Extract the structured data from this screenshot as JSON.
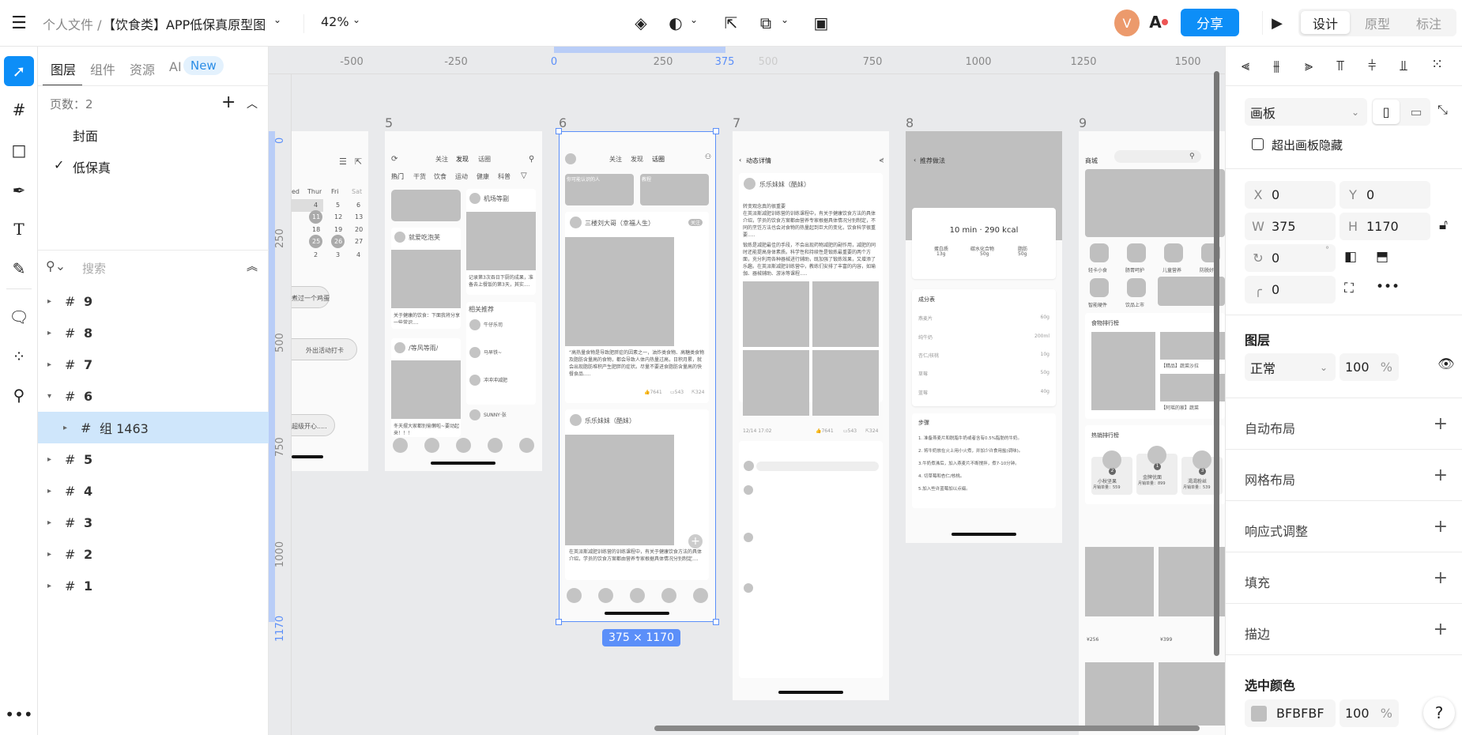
{
  "topbar": {
    "breadcrumb_root": "个人文件 /",
    "file_title": "【饮食类】APP低保真原型图",
    "zoom": "42%",
    "avatar_letter": "V",
    "share_label": "分享",
    "modes": [
      "设计",
      "原型",
      "标注"
    ],
    "active_mode": "设计"
  },
  "left_panel": {
    "tabs": [
      "图层",
      "组件",
      "资源",
      "AI"
    ],
    "new_badge": "New",
    "active_tab": "图层",
    "page_count_label": "页数：2",
    "pages": [
      {
        "name": "封面",
        "selected": false
      },
      {
        "name": "低保真",
        "selected": true
      }
    ],
    "search_placeholder": "搜索",
    "layers": [
      {
        "name": "9",
        "expanded": false
      },
      {
        "name": "8",
        "expanded": false
      },
      {
        "name": "7",
        "expanded": false
      },
      {
        "name": "6",
        "expanded": true
      },
      {
        "name": "组 1463",
        "expanded": false,
        "child": true,
        "selected": true
      },
      {
        "name": "5",
        "expanded": false
      },
      {
        "name": "4",
        "expanded": false
      },
      {
        "name": "3",
        "expanded": false
      },
      {
        "name": "2",
        "expanded": false
      },
      {
        "name": "1",
        "expanded": false
      }
    ]
  },
  "rulers": {
    "top": [
      "-500",
      "-250",
      "0",
      "250",
      "375",
      "500",
      "750",
      "1000",
      "1250",
      "1500"
    ],
    "left": [
      "0",
      "250",
      "500",
      "750",
      "1000",
      "1170"
    ]
  },
  "canvas": {
    "selection_size": "375 × 1170",
    "board4": {
      "weekdays": [
        "ed",
        "Thur",
        "Fri",
        "Sat"
      ],
      "rows": [
        [
          "4",
          "5",
          "6"
        ],
        [
          "11",
          "12",
          "13"
        ],
        [
          "18",
          "19",
          "20"
        ],
        [
          "25",
          "26",
          "27"
        ],
        [
          "2",
          "3",
          "4"
        ]
      ],
      "pills": [
        "煮过一个鸡蛋",
        "外出活动打卡",
        "超级开心....."
      ]
    },
    "board5": {
      "label": "5",
      "nav": [
        "关注",
        "发现",
        "话圈"
      ],
      "cats": [
        "热门",
        "干货",
        "饮食",
        "运动",
        "健康",
        "科普"
      ],
      "users": [
        "机场等副",
        "就爱吃泡芙",
        "/等风等雨/"
      ],
      "captions": [
        "记录第3次吞日下厨的成果，准备去上餐饭的第3天，其实....",
        "关于健康的饮食：下面我将分享一些常识....",
        "冬天摆大家都别偷懒啦~要动起来！！！"
      ],
      "related_title": "相关推荐",
      "related": [
        "牛仔乐司",
        "马早铁~",
        "冲冲冲减肥",
        "SUNNY·张"
      ]
    },
    "board6": {
      "label": "6",
      "nav": [
        "关注",
        "发现",
        "话圈"
      ],
      "cards": [
        "你可能认识的人",
        "教程"
      ],
      "post_user": "三楼刘大哥（幸福人生）",
      "follow": "关注",
      "post_text": "“高热量食物是导致肥胖症的因素之一，油炸类食物、高糖类食物及脂肪含量高的食物，都会导致人体内热量过高，日积月累，就会出现脂肪堆积产生肥胖的症状。尽量不要进食脂肪含量高的快餐食品.....",
      "likes": "7641",
      "comments": "543",
      "shares": "324",
      "post2_user": "乐乐妹妹（酷妹）",
      "post2_text": "在英派斯减肥训练营的训练课程中，有关于健康饮食方法的具体介绍，学员的饮食方案都由营养专家根据具体情况分别制定...."
    },
    "board7": {
      "label": "7",
      "title": "动态详情",
      "user": "乐乐妹妹（酷妹）",
      "headline": "转变观念真的很重要",
      "para1": "在英派斯减肥训练营的训练课程中，有关于健康饮食方法的具体介绍，学员的饮食方案都由营养专家根据具体情况分别制定，不同的烹饪方法也会对食物的热量起到巨大的变化，饮食科学很重要.....",
      "para2": "锻炼是减肥最佳的手段，不会出现药物减肥的副作用，减肥的同时还能提高身体素质。科学性和持续性是锻炼最重要的两个方面，充分利用各种器械进行辅助，既加强了锻炼效果，又增添了乐趣。在英派斯减肥训练营中，教练们安排了丰富的内容，如瑜伽、器械辅助、游泳等课程.....",
      "date": "12/14 17:02",
      "likes": "7641",
      "comments": "543",
      "shares": "324"
    },
    "board8": {
      "label": "8",
      "title": "推荐做法",
      "summary": "10 min  ·  290 kcal",
      "nutrients": [
        {
          "name": "蛋白质",
          "value": "13g"
        },
        {
          "name": "碳水化合物",
          "value": "50g"
        },
        {
          "name": "脂肪",
          "value": "50g"
        }
      ],
      "ingredients_title": "成分表",
      "ingredients": [
        {
          "name": "燕麦片",
          "amount": "60g"
        },
        {
          "name": "纯牛奶",
          "amount": "200ml"
        },
        {
          "name": "杏仁/核桃",
          "amount": "10g"
        },
        {
          "name": "草莓",
          "amount": "50g"
        },
        {
          "name": "蓝莓",
          "amount": "40g"
        }
      ],
      "steps_title": "步骤",
      "steps": [
        "1. 准备燕麦片和脱脂牛奶或者含有0.5%脂肪的牛奶。",
        "2. 将牛奶放在火上用小火煮，并加少许食用盐(调味)。",
        "3.牛奶煮沸后，加入燕麦片不断搅拌，煮7-10分钟。",
        "4. 切草莓和杏仁/核桃。",
        "5.加入些许蓝莓加以点缀。"
      ]
    },
    "board9": {
      "label": "9",
      "title": "商城",
      "categories": [
        "轻卡小食",
        "肠胃呵护",
        "儿童营养",
        "防脱好物",
        "智能硬件",
        "饮品上市"
      ],
      "ranking_title": "食物排行榜",
      "ranking_items": [
        "【精品】蔬菜沙拉",
        "【阿瑶的家】蔬菜"
      ],
      "hot_title": "热销排行榜",
      "hot": [
        {
          "rank": "2",
          "name": "小秋坚果",
          "sales": "月销单量：559"
        },
        {
          "rank": "1",
          "name": "金牌优面",
          "sales": "月销单量：899"
        },
        {
          "rank": "3",
          "name": "渴渴粉丝",
          "sales": "月销单量：539"
        }
      ],
      "price1": "¥256",
      "price2": "¥399"
    }
  },
  "right_panel": {
    "frame_type": "画板",
    "clip_label": "超出画板隐藏",
    "x": "0",
    "y": "0",
    "w": "375",
    "h": "1170",
    "rotation": "0",
    "radius": "0",
    "layer_title": "图层",
    "blend": "正常",
    "opacity": "100",
    "percent": "%",
    "sections": [
      "自动布局",
      "网格布局",
      "响应式调整",
      "填充",
      "描边"
    ],
    "selected_colors_title": "选中颜色",
    "color_hex": "BFBFBF",
    "color_value": "#bfbfbf",
    "color_opacity": "100",
    "help": "?"
  },
  "colors": {
    "accent": "#0d8ef7",
    "selection": "#5b8ff9",
    "avatar": "#ec9a6c"
  }
}
